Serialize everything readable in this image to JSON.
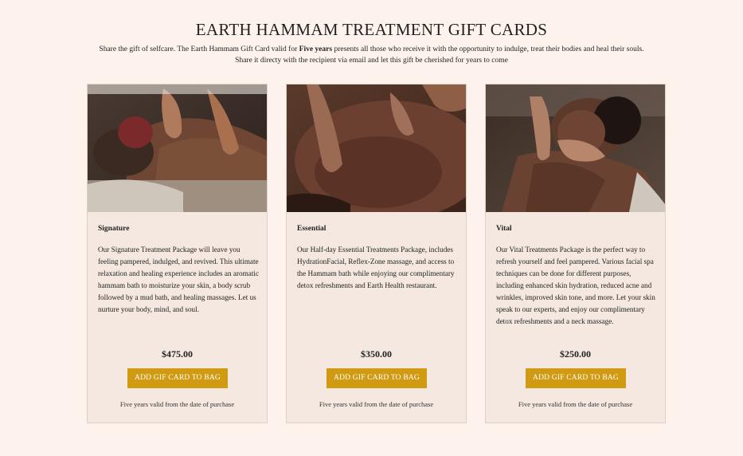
{
  "page": {
    "title": "EARTH HAMMAM TREATMENT GIFT CARDS",
    "intro_before": "Share the gift of selfcare. The Earth Hammam Gift Card valid for ",
    "intro_bold": "Five years",
    "intro_after": " presents all those who receive it with the opportunity to indulge, treat their bodies and heal their souls.",
    "intro_line2": "Share it directy with the recipient via email and let this gift be cherished for years to come"
  },
  "cards": [
    {
      "name": "Signature",
      "description": "Our Signature Treatment Package will leave you feeling pampered, indulged, and revived. This ultimate relaxation and healing experience includes an aromatic hammam bath to moisturize your skin, a body scrub followed by a mud bath, and healing massages. Let us nurture your body, mind, and soul.",
      "price": "$475.00",
      "button_label": "ADD GIF CARD TO BAG",
      "validity": "Five years valid from the date of purchase"
    },
    {
      "name": "Essential",
      "description": "Our Half-day Essential Treatments Package, includes HydrationFacial, Reflex-Zone massage, and access to the Hammam bath while enjoying our complimentary detox refreshments and Earth Health restaurant.",
      "price": "$350.00",
      "button_label": "ADD GIF CARD TO BAG",
      "validity": "Five years valid from the date of purchase"
    },
    {
      "name": "Vital",
      "description": "Our Vital Treatments Package is the perfect way to refresh yourself and feel pampered. Various facial spa techniques can be done for different purposes, including enhanced skin hydration, reduced acne and wrinkles, improved skin tone, and more. Let your skin speak to our experts, and enjoy our complimentary detox refreshments and a neck massage.",
      "price": "$250.00",
      "button_label": "ADD GIF CARD TO BAG",
      "validity": "Five years valid from the date of purchase"
    }
  ],
  "colors": {
    "page_background": "#fdf3ec",
    "card_background": "#f4e8e1",
    "button": "#d09b12"
  }
}
